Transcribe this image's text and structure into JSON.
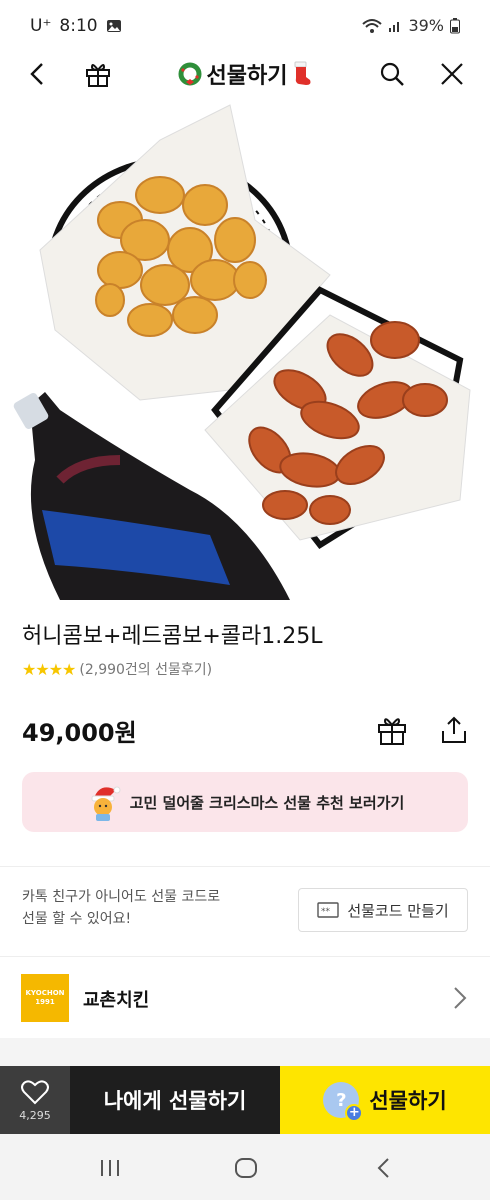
{
  "status_bar": {
    "carrier": "U⁺",
    "time": "8:10",
    "battery": "39%"
  },
  "header": {
    "title": "선물하기",
    "icons": [
      "back-icon",
      "gift-box-icon",
      "search-icon",
      "close-icon"
    ]
  },
  "product": {
    "name": "허니콤보+레드콤보+콜라1.25L",
    "rating_stars": 4,
    "review_text": "(2,990건의 선물후기)",
    "price": "49,000원"
  },
  "promo": {
    "text": "고민 덜어줄 크리스마스 선물 추천 보러가기"
  },
  "gift_code": {
    "line1": "카톡 친구가 아니어도 선물 코드로",
    "line2": "선물 할 수 있어요!",
    "button": "선물코드 만들기"
  },
  "brand": {
    "logo_top": "KYOCHON",
    "logo_bottom": "1991",
    "name": "교촌치킨"
  },
  "bottom_bar": {
    "like_count": "4,295",
    "self_gift": "나에게 선물하기",
    "gift": "선물하기"
  },
  "colors": {
    "accent_yellow": "#fee500",
    "dark": "#1e1e1e",
    "promo_bg": "#fbe5ea",
    "star": "#f7c600",
    "brand_logo": "#f5b800"
  }
}
